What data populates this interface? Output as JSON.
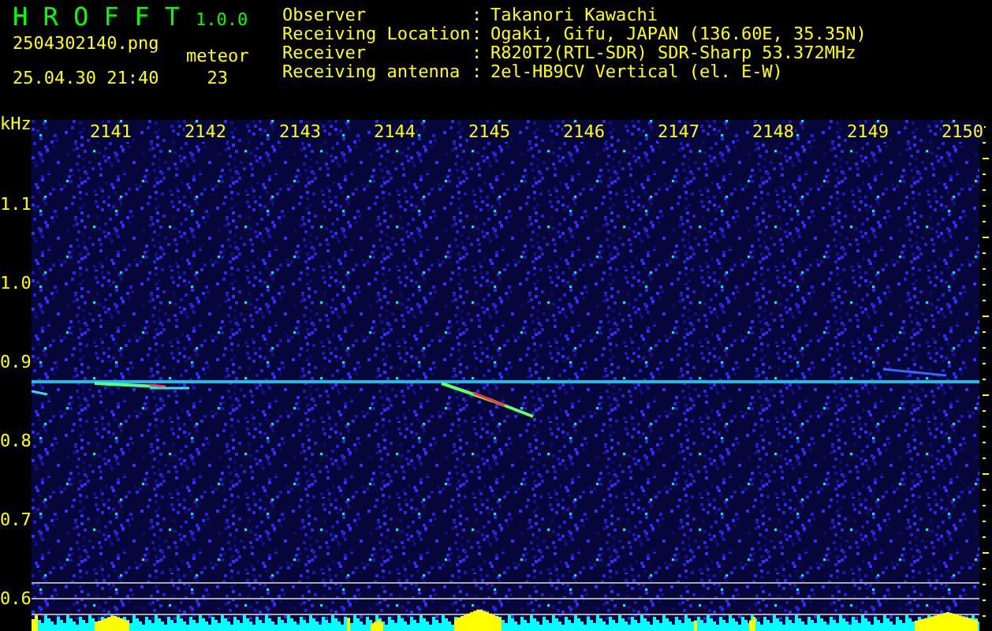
{
  "app": {
    "title": "H R O F F T",
    "version": "1.0.0"
  },
  "file": {
    "name": "2504302140.png",
    "timestamp": "25.04.30 21:40"
  },
  "count": {
    "label": "meteor",
    "value": "23"
  },
  "info": [
    {
      "label": "Observer",
      "separator": ":",
      "value": "Takanori Kawachi"
    },
    {
      "label": "Receiving Location",
      "separator": ":",
      "value": "Ogaki, Gifu, JAPAN (136.60E, 35.35N)"
    },
    {
      "label": "Receiver",
      "separator": ":",
      "value": "R820T2(RTL-SDR) SDR-Sharp 53.372MHz"
    },
    {
      "label": "Receiving antenna",
      "separator": ":",
      "value": "2el-HB9CV Vertical (el. E-W)"
    }
  ],
  "spectrogram": {
    "y_unit": "kHz",
    "x_ticks": [
      "2141",
      "2142",
      "2143",
      "2144",
      "2145",
      "2146",
      "2147",
      "2148",
      "2149",
      "2150"
    ],
    "y_ticks": [
      "1.1",
      "1.0",
      "0.9",
      "0.8",
      "0.7",
      "0.6"
    ]
  }
}
